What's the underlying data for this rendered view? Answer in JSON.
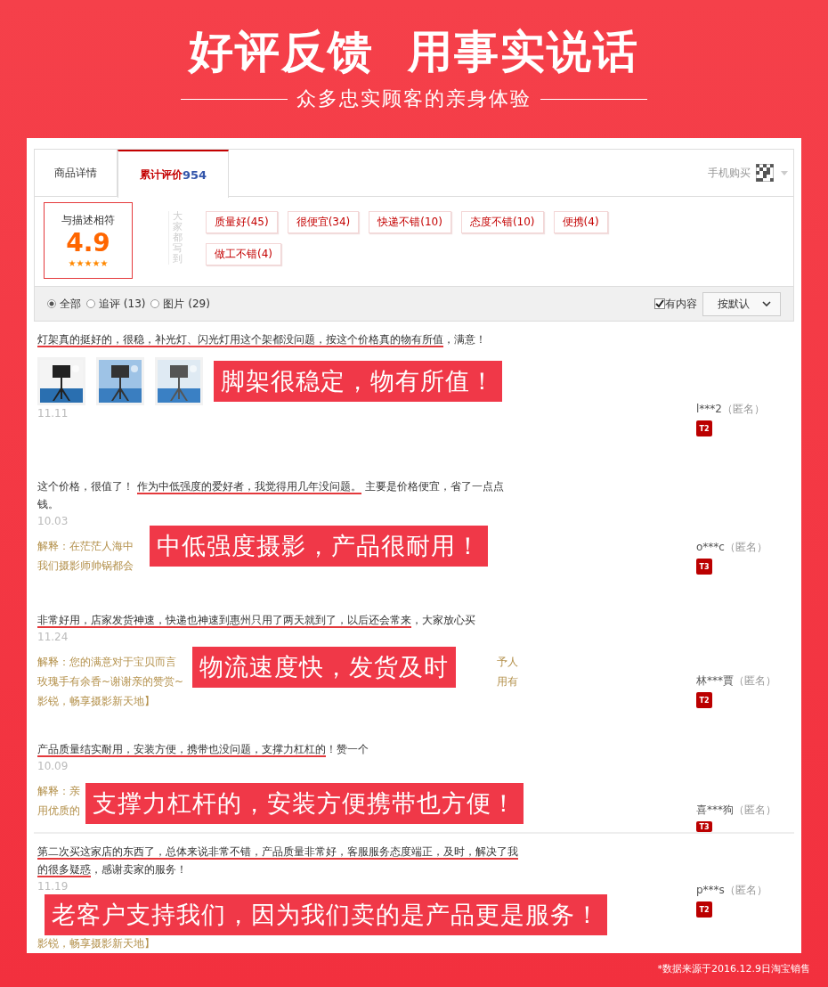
{
  "header": {
    "title": "好评反馈  用事实说话",
    "subtitle": "众多忠实顾客的亲身体验"
  },
  "tabs": [
    {
      "label": "商品详情",
      "selected": false
    },
    {
      "label": "累计评价",
      "count": "954",
      "selected": true
    }
  ],
  "mobile_buy": {
    "label": "手机购买"
  },
  "rating": {
    "label": "与描述相符",
    "score": "4.9",
    "stars": 5
  },
  "tags_title": "大家都写到",
  "tags": [
    {
      "label": "质量好(45)"
    },
    {
      "label": "很便宜(34)"
    },
    {
      "label": "快递不错(10)"
    },
    {
      "label": "态度不错(10)"
    },
    {
      "label": "便携(4)"
    },
    {
      "label": "做工不错(4)"
    }
  ],
  "filters": [
    {
      "label": "全部",
      "selected": true
    },
    {
      "label": "追评 (13)",
      "selected": false
    },
    {
      "label": "图片 (29)",
      "selected": false
    }
  ],
  "content_filter": {
    "label": "有内容",
    "checked": true
  },
  "sort": {
    "label": "按默认"
  },
  "reviews": [
    {
      "text": [
        {
          "t": "灯架真的挺好的，很稳，补光灯、闪光灯用这个架都没问题，按这个价格真的物有所值",
          "underlined": true
        },
        {
          "t": "，满意！",
          "underlined": false
        }
      ],
      "photos": [
        {
          "kind": "picture"
        },
        {
          "kind": "picture"
        },
        {
          "kind": "picture"
        }
      ],
      "date": "11.11",
      "banner": "脚架很稳定，物有所值！",
      "user": "l***2",
      "anon": "（匿名）",
      "badge": "T2"
    },
    {
      "text": [
        {
          "t": "这个价格，很值了！ ",
          "underlined": false
        },
        {
          "t": "作为中低强度的爱好者，我觉得用几年没问题。",
          "underlined": true
        },
        {
          "t": " 主要是价格便宜，省了一点点钱。",
          "underlined": false
        }
      ],
      "date": "10.03",
      "reply": [
        {
          "left": "解释：在茫茫人海中"
        },
        {
          "left": "我们摄影师帅锅都会"
        }
      ],
      "banner": "中低强度摄影，产品很耐用！",
      "user": "o***c",
      "anon": "（匿名）",
      "badge": "T3"
    },
    {
      "text": [
        {
          "t": "非常好用，店家发货神速，快递也神速到惠州只用了两天就到了，以后还会常来",
          "underlined": true
        },
        {
          "t": "，大家放心买",
          "underlined": false
        }
      ],
      "date": "11.24",
      "reply": [
        {
          "left": "解释：您的满意对于宝贝而言",
          "right": "予人"
        },
        {
          "left": "玫瑰手有余香~谢谢亲的赞赏~",
          "right": "用有"
        },
        {
          "left": "影锐，畅享摄影新天地】"
        }
      ],
      "banner": "物流速度快，发货及时",
      "user": "林***賈",
      "anon": "（匿名）",
      "badge": "T2"
    },
    {
      "text": [
        {
          "t": "产品质量结实耐用，安装方便，携带也没问题，支撑力杠杠的",
          "underlined": true
        },
        {
          "t": "！赞一个",
          "underlined": false
        }
      ],
      "date": "10.09",
      "reply": [
        {
          "left": "解释：亲"
        },
        {
          "left": "用优质的"
        }
      ],
      "banner": "支撑力杠杆的，安装方便携带也方便！",
      "user": "喜***狗",
      "anon": "（匿名）",
      "badge": "T3"
    },
    {
      "text": [
        {
          "t": "第二次买这家店的东西了，总体来说非常不错，产品质量非常好，客服服务态度端正，及时，",
          "underlined": true
        },
        {
          "t": "解决了我的很多疑惑",
          "underlined": true
        },
        {
          "t": "，感谢卖家的服务！",
          "underlined": false
        }
      ],
      "date": "11.19",
      "reply": [
        {
          "left": "影锐，畅享摄影新天地】"
        }
      ],
      "banner": "老客户支持我们，因为我们卖的是产品更是服务！",
      "user": "p***s",
      "anon": "（匿名）",
      "badge": "T2"
    }
  ],
  "footnote": "*数据来源于2016.12.9日淘宝销售"
}
